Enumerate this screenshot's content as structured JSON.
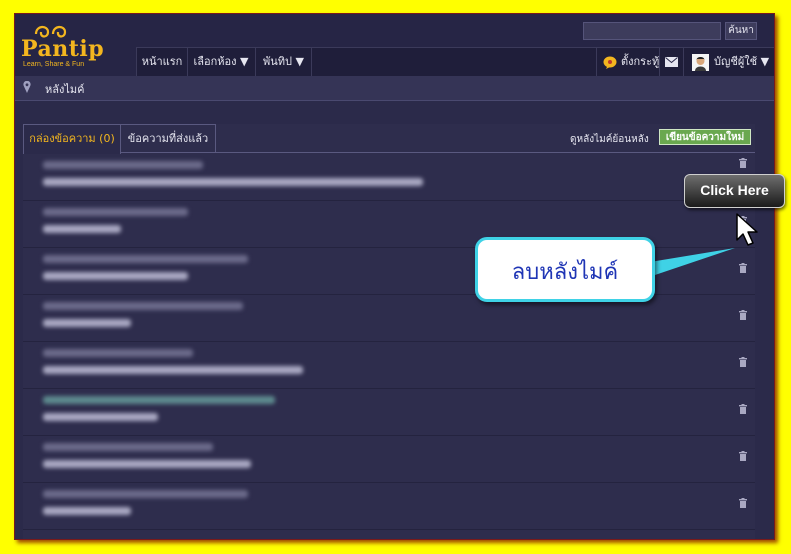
{
  "header": {
    "logo_text": "Pantip",
    "logo_tagline": "Learn, Share & Fun",
    "search_placeholder": "",
    "search_button": "ค้นหา"
  },
  "nav": {
    "items": [
      {
        "label": "หน้าแรก"
      },
      {
        "label": "เลือกห้อง ▼"
      },
      {
        "label": "พันทิป ▼"
      }
    ],
    "right": {
      "notifications": "ตั้งกระทู้",
      "account": "บัญชีผู้ใช้ ▼"
    }
  },
  "breadcrumb": {
    "label": "หลังไมค์"
  },
  "tabs": [
    {
      "label": "กล่องข้อความ (0)"
    },
    {
      "label": "ข้อความที่ส่งแล้ว"
    }
  ],
  "toolbar": {
    "view_back": "ดูหลังไมค์ย้อนหลัง",
    "write_button": "เขียนข้อความใหม่"
  },
  "annotation": {
    "callout": "ลบหลังไมค์",
    "click_here": "Click Here"
  },
  "colors": {
    "background": "#ffff00",
    "page": "#2b2a4a",
    "accent": "#f3b61f",
    "callout_border": "#3fd2e6",
    "callout_text": "#1f35b5",
    "button_green": "#6aa84f"
  }
}
